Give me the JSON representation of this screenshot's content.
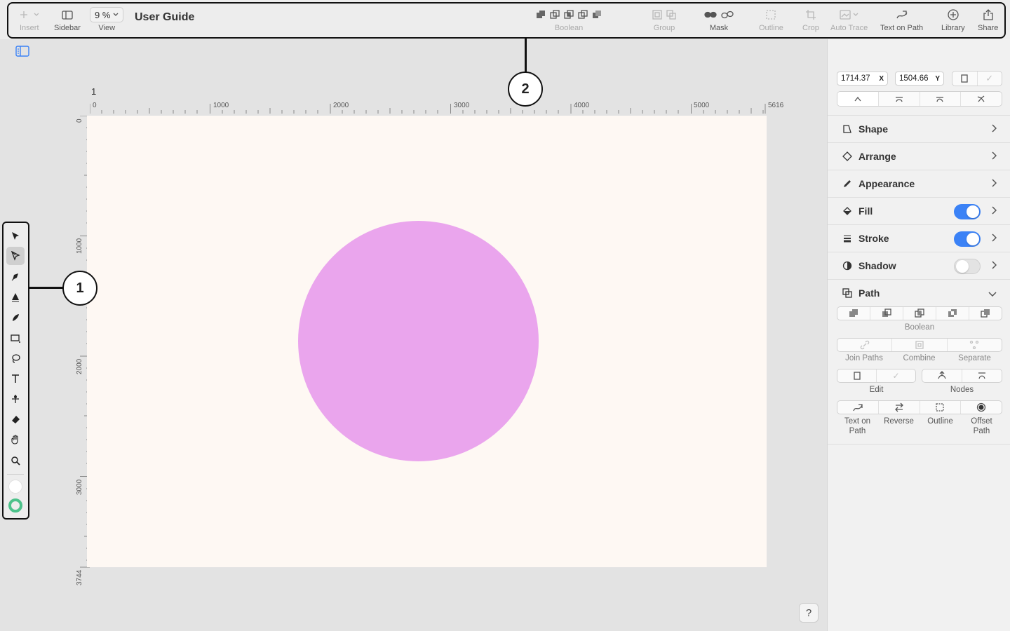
{
  "toolbar": {
    "insert": "Insert",
    "sidebar": "Sidebar",
    "zoom": "9 %",
    "view": "View",
    "title": "User Guide",
    "boolean": "Boolean",
    "group": "Group",
    "mask": "Mask",
    "outline": "Outline",
    "crop": "Crop",
    "auto_trace": "Auto Trace",
    "text_on_path": "Text on Path",
    "library": "Library",
    "share": "Share"
  },
  "canvas": {
    "page_number": "1",
    "ruler_h": [
      "0",
      "1000",
      "2000",
      "3000",
      "4000",
      "5000",
      "5616"
    ],
    "ruler_v": [
      "0",
      "1000",
      "2000",
      "3000",
      "3744"
    ],
    "shape_color": "#eaa5ed",
    "artboard_color": "#fef8f3"
  },
  "tools": [
    "select",
    "node-select",
    "pen",
    "vector-pen",
    "brush",
    "rectangle",
    "lasso",
    "text",
    "knife",
    "eraser",
    "hand",
    "zoom"
  ],
  "callouts": [
    "1",
    "2"
  ],
  "help": "?",
  "inspector": {
    "x_value": "1714.37",
    "x_label": "X",
    "y_value": "1504.66",
    "y_label": "Y",
    "check": "✓",
    "sections": {
      "shape": "Shape",
      "arrange": "Arrange",
      "appearance": "Appearance",
      "fill": "Fill",
      "stroke": "Stroke",
      "shadow": "Shadow",
      "path": "Path"
    },
    "toggles": {
      "fill": true,
      "stroke": true,
      "shadow": false
    },
    "path": {
      "boolean": "Boolean",
      "join_paths": "Join Paths",
      "combine": "Combine",
      "separate": "Separate",
      "edit": "Edit",
      "nodes": "Nodes",
      "text_on_path_1": "Text on",
      "text_on_path_2": "Path",
      "reverse": "Reverse",
      "outline": "Outline",
      "offset_path_1": "Offset",
      "offset_path_2": "Path"
    },
    "accent": "#3b82f6"
  }
}
